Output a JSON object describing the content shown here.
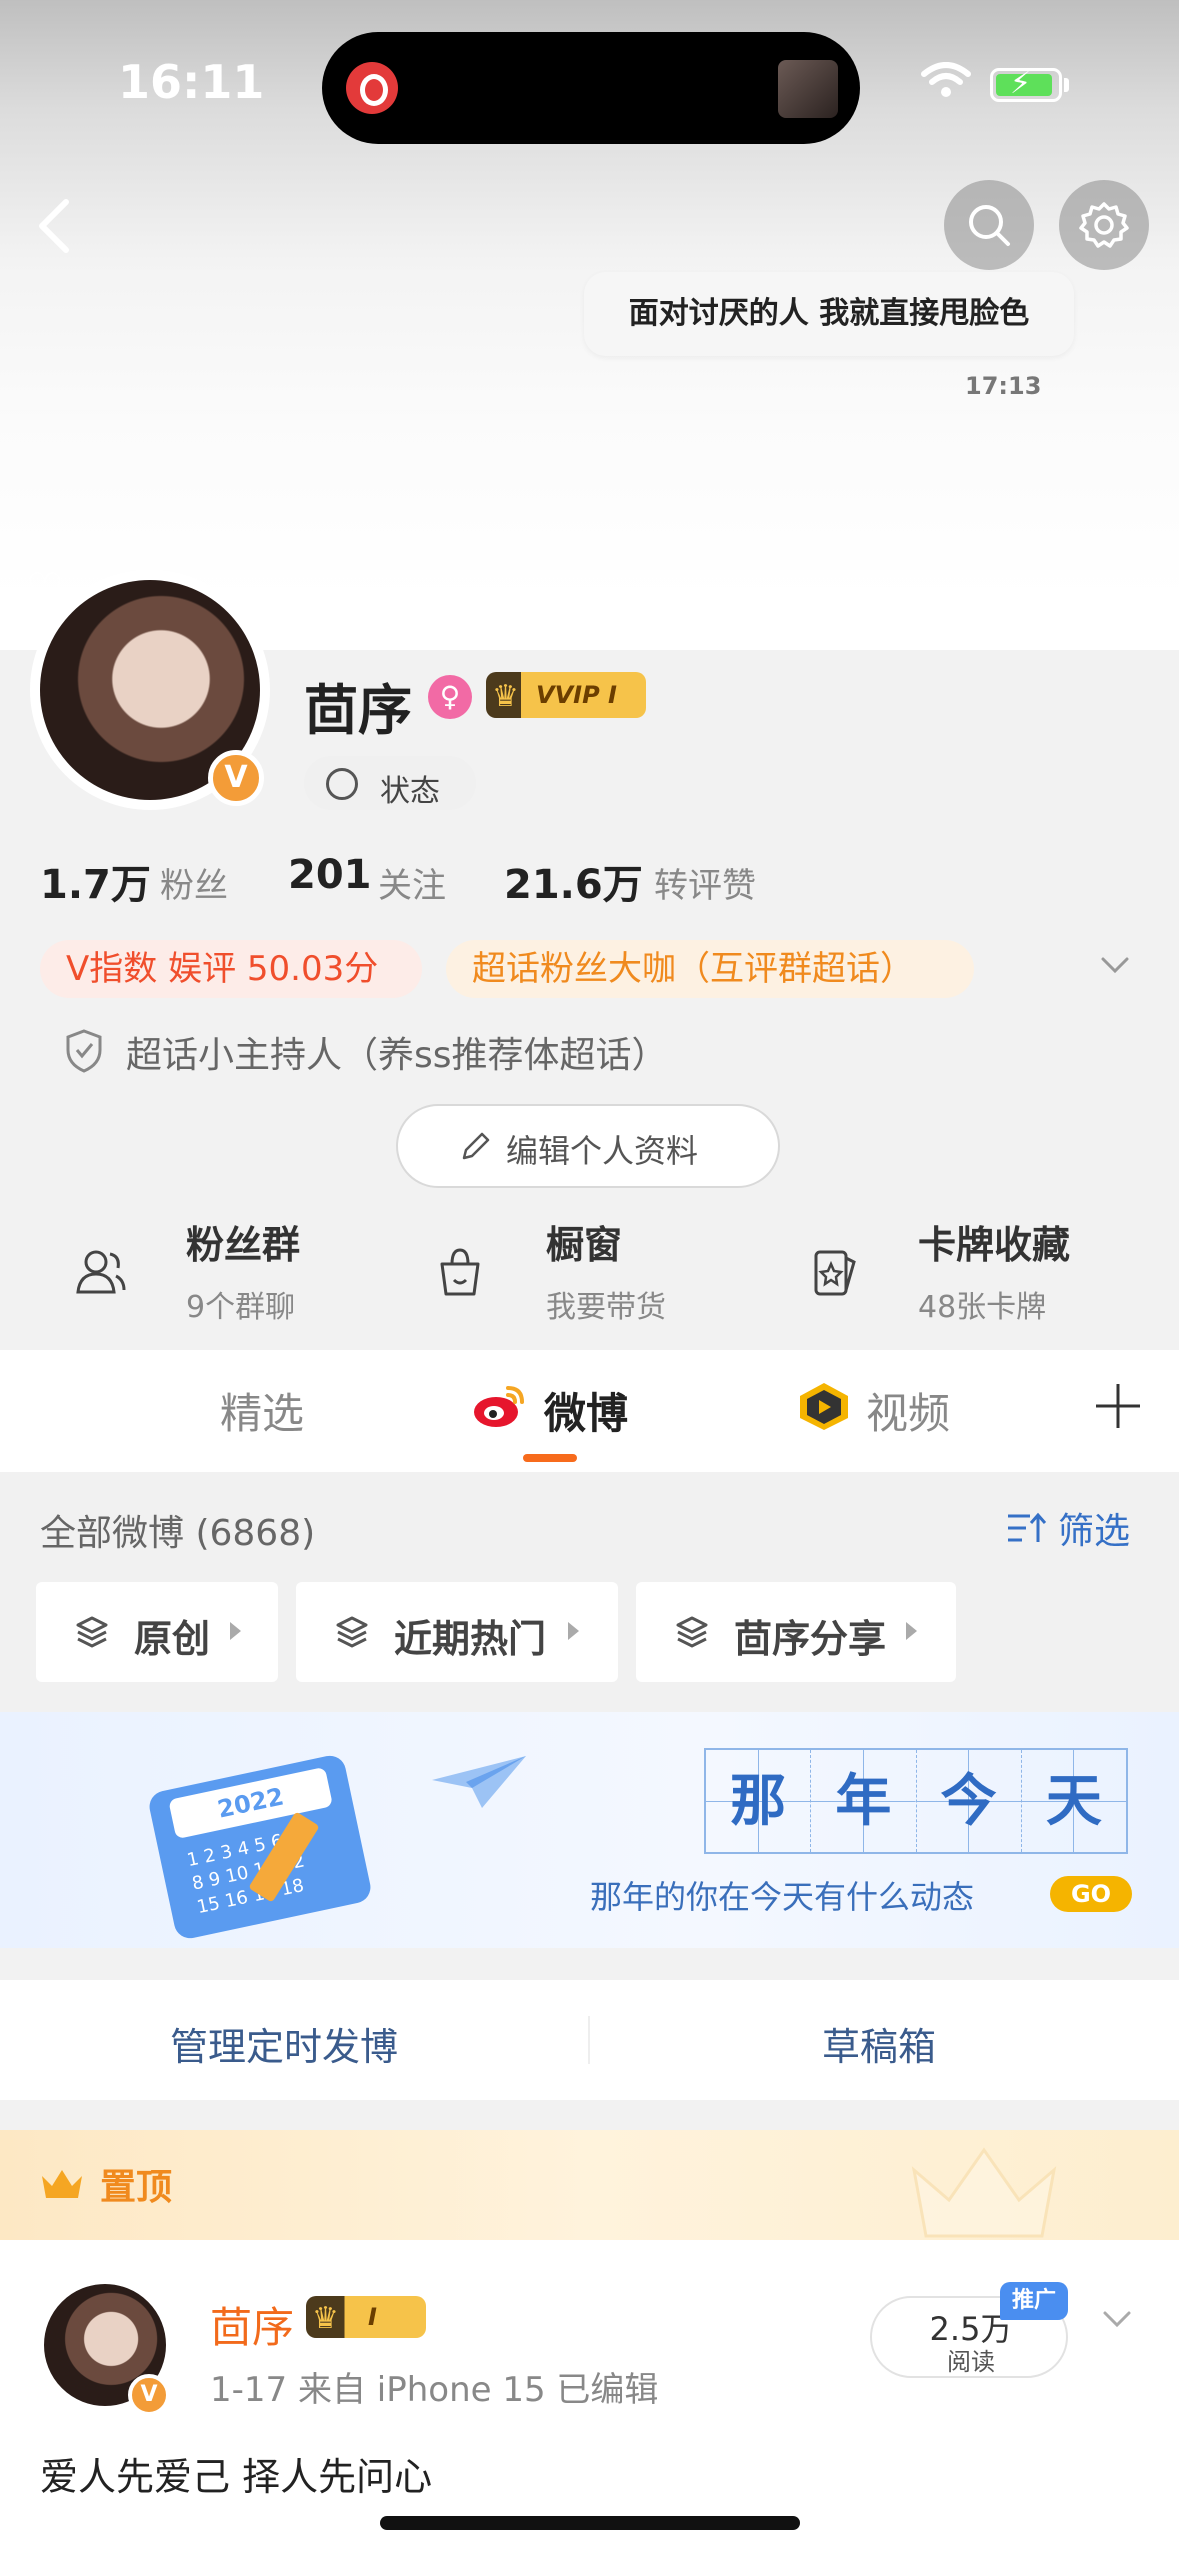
{
  "status_bar": {
    "time": "16:11"
  },
  "chat_preview": {
    "message": "面对讨厌的人 我就直接甩脸色",
    "time": "17:13"
  },
  "profile": {
    "name": "茴序",
    "vip_badge": "VVIP I",
    "status_label": "状态",
    "stats": [
      {
        "num": "1.7万",
        "label": "粉丝"
      },
      {
        "num": "201",
        "label": "关注"
      },
      {
        "num": "21.6万",
        "label": "转评赞"
      }
    ],
    "tags": [
      "V指数 娱评 50.03分",
      "超话粉丝大咖（互评群超话）"
    ],
    "host_line": "超话小主持人（养ss推荐体超话）",
    "edit_label": "编辑个人资料"
  },
  "quick_actions": [
    {
      "title": "粉丝群",
      "sub": "9个群聊",
      "icon": "users-icon"
    },
    {
      "title": "橱窗",
      "sub": "我要带货",
      "icon": "shopping-bag-icon"
    },
    {
      "title": "卡牌收藏",
      "sub": "48张卡牌",
      "icon": "card-icon"
    }
  ],
  "tabs": [
    "精选",
    "微博",
    "视频"
  ],
  "feed_header": {
    "all_label": "全部微博 (6868)",
    "filter_label": "筛选"
  },
  "filter_chips": [
    "原创",
    "近期热门",
    "茴序分享"
  ],
  "banner": {
    "calendar_year": "2022",
    "calendar_rows": [
      "1 2 3 4 5 6",
      "8 9 10 11 12",
      "15 16 17 18"
    ],
    "title_chars": [
      "那",
      "年",
      "今",
      "天"
    ],
    "subtitle": "那年的你在今天有什么动态",
    "go_label": "GO"
  },
  "drafts": {
    "scheduled": "管理定时发博",
    "drafts": "草稿箱"
  },
  "pinned_post": {
    "pinned_label": "置顶",
    "author": "茴序",
    "vip_badge": "I",
    "meta": "1-17  来自 iPhone 15  已编辑",
    "reads_num": "2.5万",
    "reads_label": "阅读",
    "promo": "推广",
    "body": "爱人先爱己 择人先问心"
  },
  "colors": {
    "accent_orange": "#f76b1c",
    "link_blue": "#3570c6",
    "tag_red": "#f04e2c"
  }
}
